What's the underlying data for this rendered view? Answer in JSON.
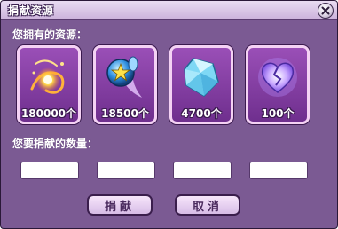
{
  "window": {
    "title": "捐献资源",
    "close_icon": "close-icon"
  },
  "labels": {
    "owned_resources": "您拥有的资源：",
    "donate_amount": "您要捐献的数量："
  },
  "resources": [
    {
      "icon": "fire-orb-icon",
      "amount": "180000个"
    },
    {
      "icon": "star-gem-icon",
      "amount": "18500个"
    },
    {
      "icon": "crystal-icon",
      "amount": "4700个"
    },
    {
      "icon": "broken-heart-icon",
      "amount": "100个"
    }
  ],
  "inputs": [
    {
      "value": ""
    },
    {
      "value": ""
    },
    {
      "value": ""
    },
    {
      "value": ""
    }
  ],
  "buttons": {
    "donate": "捐献",
    "cancel": "取消"
  }
}
